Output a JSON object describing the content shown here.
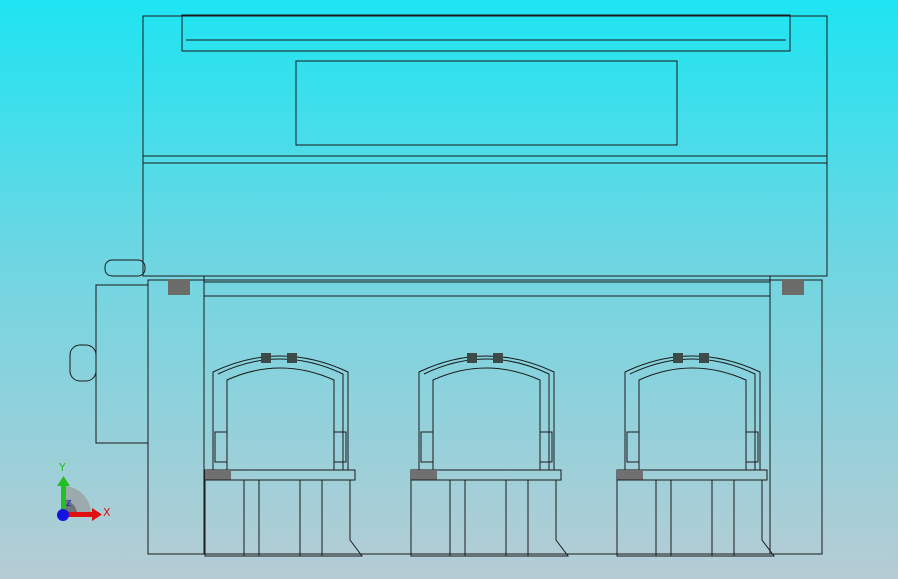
{
  "viewport": {
    "background_top": "#1ee4f2",
    "background_bottom": "#b6ccd4"
  },
  "model": {
    "body_color": "#c6c6be",
    "top_color": "#8a8a84",
    "pocket_count": 3
  },
  "triad": {
    "x_label": "X",
    "y_label": "Y",
    "z_label": "Z",
    "x_color": "#e01010",
    "y_color": "#20c020",
    "z_color": "#1010e0"
  }
}
